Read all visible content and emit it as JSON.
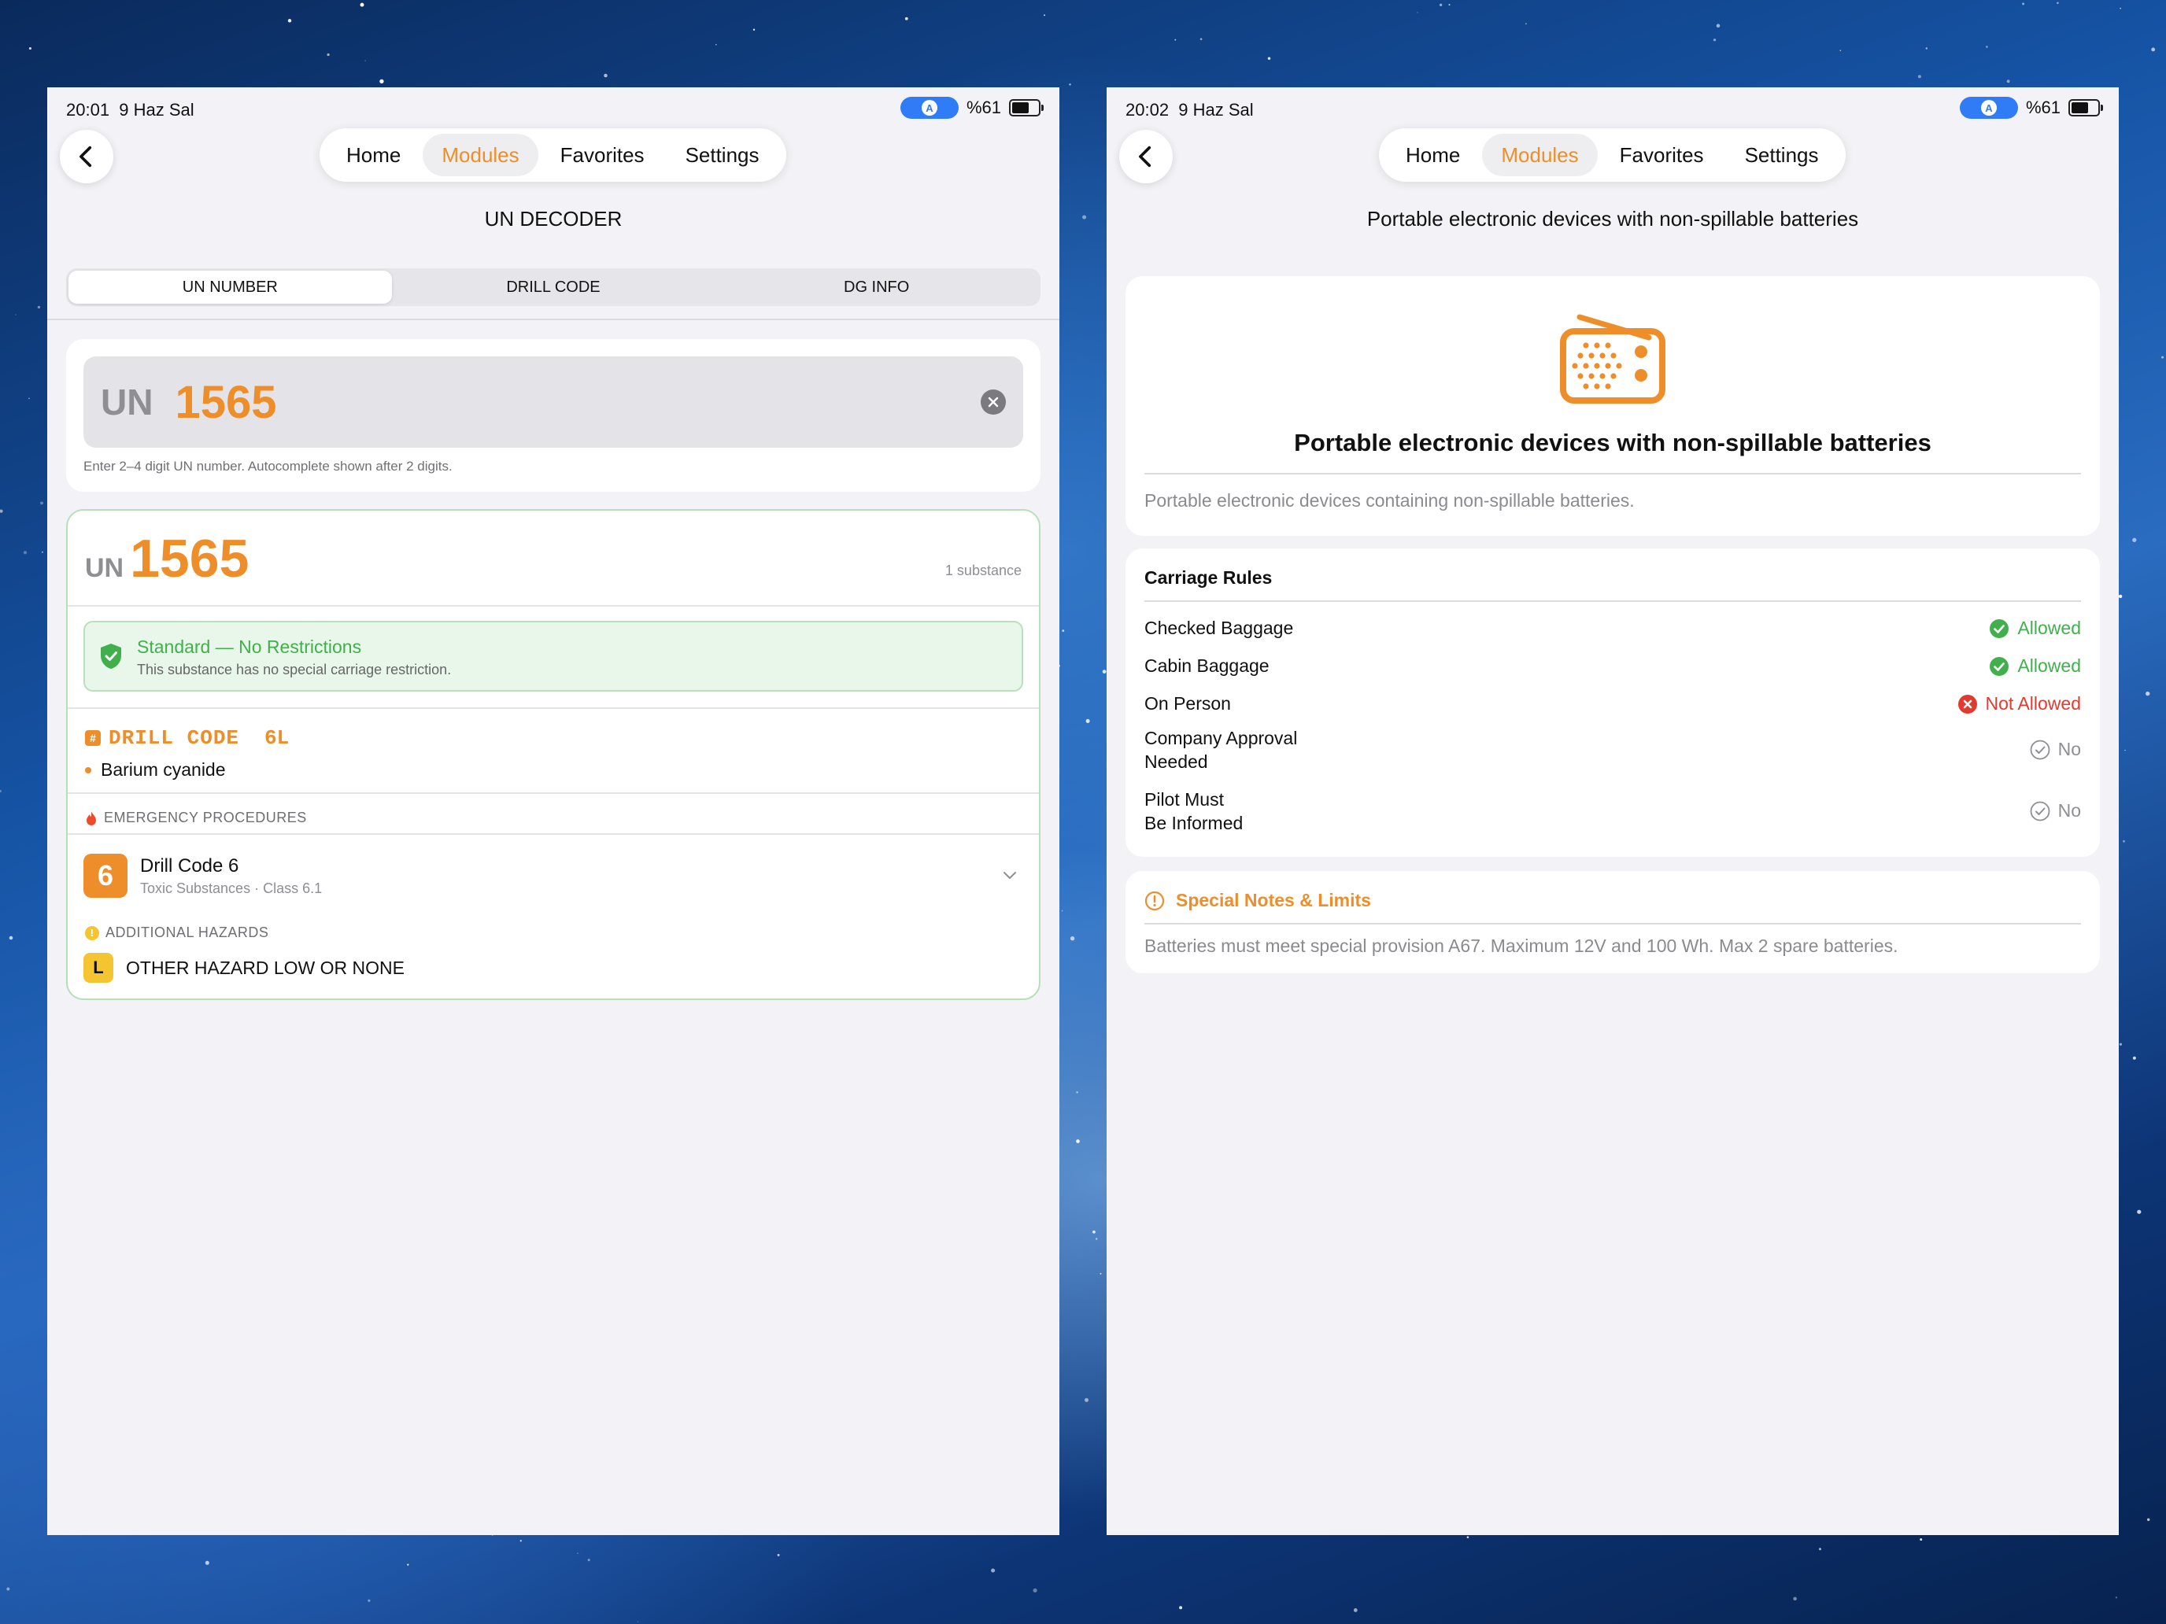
{
  "left": {
    "status": {
      "time": "20:01",
      "date": "9 Haz Sal",
      "battery": "%61"
    },
    "nav": {
      "tabs": [
        "Home",
        "Modules",
        "Favorites",
        "Settings"
      ],
      "active": "Modules"
    },
    "title": "UN DECODER",
    "segments": [
      "UN NUMBER",
      "DRILL CODE",
      "DG INFO"
    ],
    "active_segment": "UN NUMBER",
    "input": {
      "prefix": "UN",
      "value": "1565",
      "hint": "Enter 2–4 digit UN number. Autocomplete shown after 2 digits."
    },
    "result": {
      "prefix": "UN",
      "number": "1565",
      "count": "1 substance",
      "status_title": "Standard — No Restrictions",
      "status_desc": "This substance has no special carriage restriction.",
      "drill_label": "DRILL CODE",
      "drill_code": "6L",
      "substance": "Barium cyanide",
      "emergency_label": "EMERGENCY PROCEDURES",
      "drill_badge": "6",
      "drill_title": "Drill Code 6",
      "drill_sub": "Toxic Substances · Class 6.1",
      "additional_label": "ADDITIONAL HAZARDS",
      "hazard_badge": "L",
      "hazard_text": "OTHER HAZARD LOW OR NONE"
    }
  },
  "right": {
    "status": {
      "time": "20:02",
      "date": "9 Haz Sal",
      "battery": "%61"
    },
    "nav": {
      "tabs": [
        "Home",
        "Modules",
        "Favorites",
        "Settings"
      ],
      "active": "Modules"
    },
    "title": "Portable electronic devices with non-spillable batteries",
    "device": {
      "icon": "radio-icon",
      "name": "Portable electronic devices with non-spillable batteries",
      "desc": "Portable electronic devices containing non-spillable batteries."
    },
    "rules": {
      "heading": "Carriage Rules",
      "items": [
        {
          "label": "Checked Baggage",
          "status": "Allowed",
          "kind": "ok"
        },
        {
          "label": "Cabin Baggage",
          "status": "Allowed",
          "kind": "ok"
        },
        {
          "label": "On Person",
          "status": "Not Allowed",
          "kind": "no"
        },
        {
          "label": "Company Approval\nNeeded",
          "status": "No",
          "kind": "neutral"
        },
        {
          "label": "Pilot Must\nBe Informed",
          "status": "No",
          "kind": "neutral"
        }
      ]
    },
    "notes": {
      "heading": "Special Notes & Limits",
      "text": "Batteries must meet special provision A67. Maximum 12V and 100 Wh. Max 2 spare batteries."
    }
  },
  "colors": {
    "accent": "#ee8e2a",
    "ok": "#41b04c",
    "no": "#e03b2f",
    "background": "#f2f2f7"
  }
}
